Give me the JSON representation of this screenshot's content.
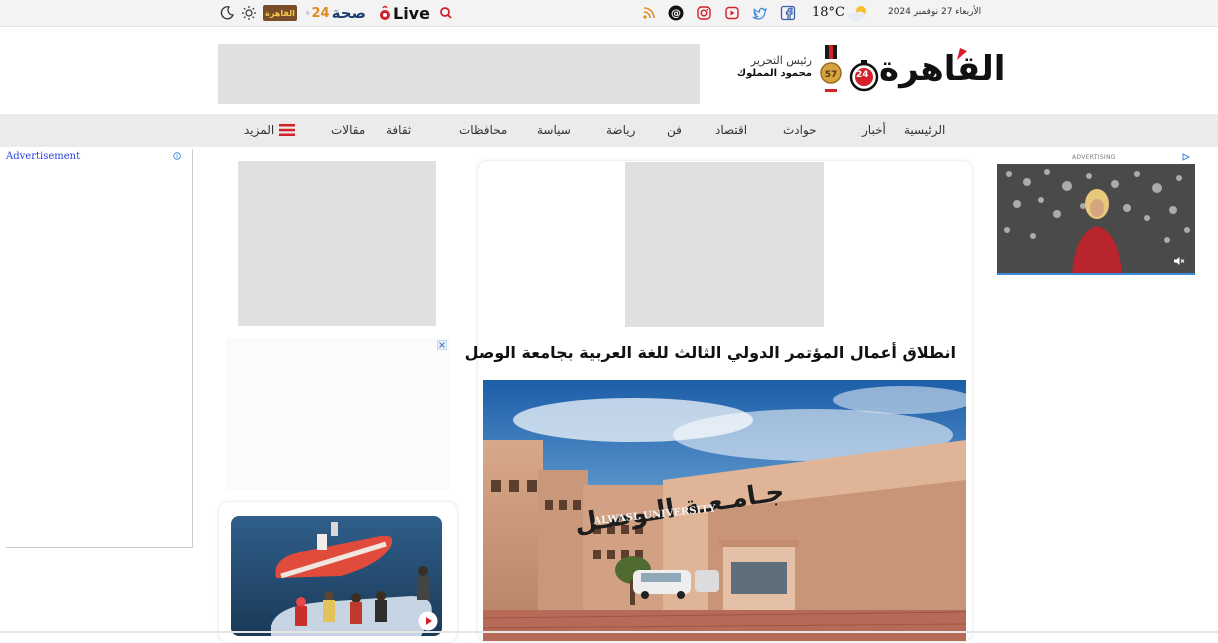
{
  "topbar": {
    "date": "الأربعاء 27 نوفمبر 2024",
    "temperature": "18°C",
    "live_label": "Live",
    "health_label": "صحة",
    "health_number": "24",
    "alqahera_badge": "القاهرة",
    "num24": "24"
  },
  "header": {
    "logo_text": "القاهرة",
    "logo_number": "24",
    "editor_title": "رئيس التحرير",
    "editor_name": "محمود المملوك"
  },
  "nav": {
    "items": [
      "الرئيسية",
      "أخبار",
      "حوادث",
      "اقتصاد",
      "فن",
      "رياضة",
      "سياسة",
      "محافظات",
      "ثقافة",
      "مقالات"
    ],
    "more_label": "المزيد"
  },
  "left_ad": {
    "label": "Advertisement"
  },
  "right_ad": {
    "label": "ADVERTISING"
  },
  "article": {
    "headline": "انطلاق أعمال المؤتمر الدولي الثالث للغة العربية بجامعة الوصل",
    "photo_sign_ar": "جـامـعـة الـوصـل",
    "photo_sign_en": "ALWASL UNIVERSITY"
  },
  "colors": {
    "accent_red": "#d3202a",
    "nav_bg": "#ebebeb",
    "topbar_bg": "#f3f3f3",
    "placeholder": "#e0e0e0"
  }
}
